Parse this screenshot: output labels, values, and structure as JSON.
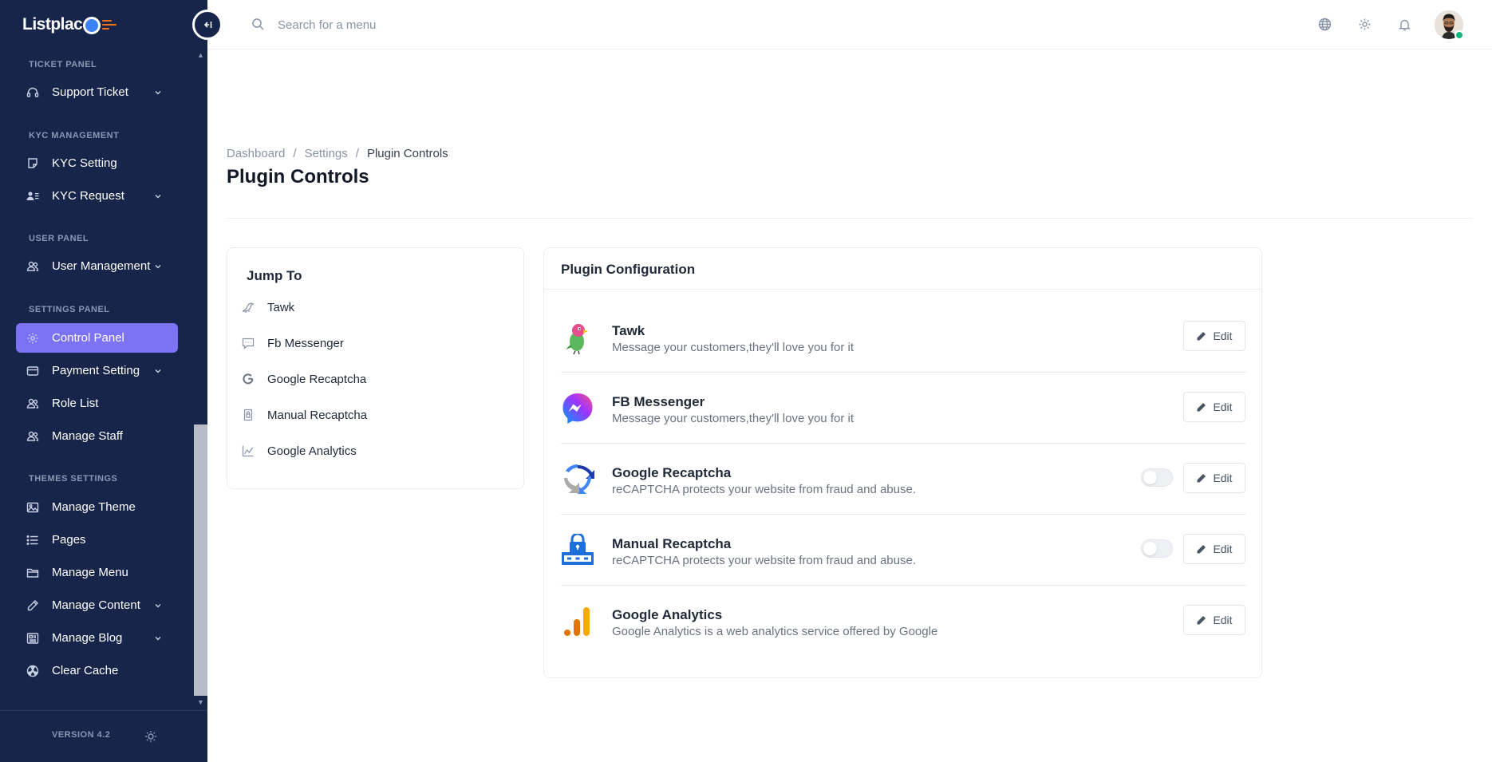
{
  "app": {
    "logo_text": "Listplac",
    "version": "VERSION 4.2"
  },
  "search": {
    "placeholder": "Search for a menu"
  },
  "sidebar": {
    "sections": [
      {
        "label": "TICKET PANEL"
      },
      {
        "label": "KYC MANAGEMENT"
      },
      {
        "label": "USER PANEL"
      },
      {
        "label": "SETTINGS PANEL"
      },
      {
        "label": "THEMES SETTINGS"
      }
    ],
    "items": [
      {
        "label": "Support Ticket",
        "icon": "headset-icon",
        "has_submenu": true
      },
      {
        "label": "KYC Setting",
        "icon": "sticker-icon",
        "has_submenu": false
      },
      {
        "label": "KYC Request",
        "icon": "user-list-icon",
        "has_submenu": true
      },
      {
        "label": "User Management",
        "icon": "users-icon",
        "has_submenu": true
      },
      {
        "label": "Control Panel",
        "icon": "gear-icon",
        "has_submenu": false,
        "active": true
      },
      {
        "label": "Payment Setting",
        "icon": "wallet-icon",
        "has_submenu": true
      },
      {
        "label": "Role List",
        "icon": "users-icon",
        "has_submenu": false
      },
      {
        "label": "Manage Staff",
        "icon": "users-icon",
        "has_submenu": false
      },
      {
        "label": "Manage Theme",
        "icon": "image-icon",
        "has_submenu": false
      },
      {
        "label": "Pages",
        "icon": "list-icon",
        "has_submenu": false
      },
      {
        "label": "Manage Menu",
        "icon": "folder-icon",
        "has_submenu": false
      },
      {
        "label": "Manage Content",
        "icon": "pencil-icon",
        "has_submenu": true
      },
      {
        "label": "Manage Blog",
        "icon": "newspaper-icon",
        "has_submenu": true
      },
      {
        "label": "Clear Cache",
        "icon": "radiation-icon",
        "has_submenu": false
      }
    ]
  },
  "breadcrumb": {
    "items": [
      "Dashboard",
      "Settings",
      "Plugin Controls"
    ],
    "separator": "/"
  },
  "page": {
    "title": "Plugin Controls"
  },
  "jump": {
    "title": "Jump To",
    "items": [
      {
        "label": "Tawk",
        "icon": "bird-icon"
      },
      {
        "label": "Fb Messenger",
        "icon": "message-icon"
      },
      {
        "label": "Google Recaptcha",
        "icon": "google-icon"
      },
      {
        "label": "Manual Recaptcha",
        "icon": "document-icon"
      },
      {
        "label": "Google Analytics",
        "icon": "chart-icon"
      }
    ]
  },
  "plugins": {
    "title": "Plugin Configuration",
    "edit_label": "Edit",
    "items": [
      {
        "name": "Tawk",
        "description": "Message your customers,they'll love you for it",
        "logo": "tawk-logo",
        "toggle": null
      },
      {
        "name": "FB Messenger",
        "description": "Message your customers,they'll love you for it",
        "logo": "messenger-logo",
        "toggle": null
      },
      {
        "name": "Google Recaptcha",
        "description": "reCAPTCHA protects your website from fraud and abuse.",
        "logo": "recaptcha-logo",
        "toggle": false
      },
      {
        "name": "Manual Recaptcha",
        "description": "reCAPTCHA protects your website from fraud and abuse.",
        "logo": "lock-logo",
        "toggle": false
      },
      {
        "name": "Google Analytics",
        "description": "Google Analytics is a web analytics service offered by Google",
        "logo": "analytics-logo",
        "toggle": null
      }
    ]
  },
  "colors": {
    "sidebar_bg": "#17254a",
    "accent": "#7b72f5",
    "online": "#10b981"
  }
}
